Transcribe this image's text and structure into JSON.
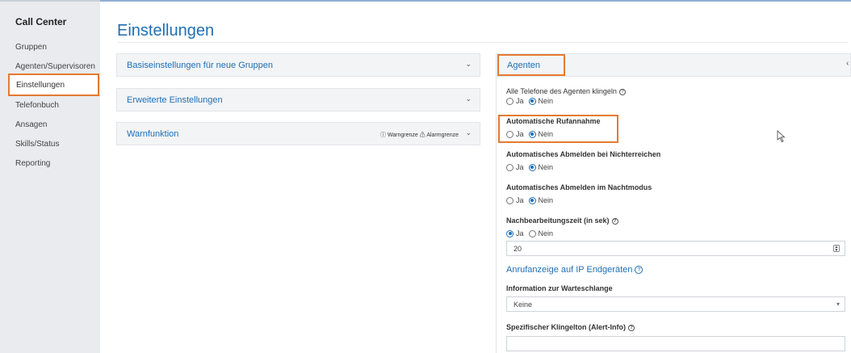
{
  "sidebar": {
    "title": "Call Center",
    "items": [
      {
        "label": "Gruppen"
      },
      {
        "label": "Agenten/Supervisoren"
      },
      {
        "label": "Einstellungen",
        "active": true
      },
      {
        "label": "Telefonbuch"
      },
      {
        "label": "Ansagen"
      },
      {
        "label": "Skills/Status"
      },
      {
        "label": "Reporting"
      }
    ]
  },
  "main": {
    "title": "Einstellungen",
    "accordions": [
      {
        "label": "Basiseinstellungen für neue Gruppen"
      },
      {
        "label": "Erweiterte Einstellungen"
      },
      {
        "label": "Warnfunktion",
        "legend": {
          "warn": "Warngrenze",
          "alarm": "Alarmgrenze"
        }
      }
    ]
  },
  "agents": {
    "header": "Agenten",
    "yes": "Ja",
    "no": "Nein",
    "ring_all": {
      "label": "Alle Telefone des Agenten klingeln"
    },
    "auto_answer": {
      "label": "Automatische Rufannahme"
    },
    "auto_logout_unreach": {
      "label": "Automatisches Abmelden bei Nichterreichen"
    },
    "auto_logout_night": {
      "label": "Automatisches Abmelden im Nachtmodus"
    },
    "wrapup": {
      "label": "Nachbearbeitungszeit (in sek)",
      "value": "20"
    },
    "call_display_link": "Anrufanzeige auf IP Endgeräten",
    "queue_info": {
      "label": "Information zur Warteschlange",
      "value": "Keine"
    },
    "ringtone": {
      "label": "Spezifischer Klingelton (Alert-Info)",
      "value": ""
    }
  },
  "colors": {
    "accent": "#1f6fb5",
    "highlight": "#e57a32",
    "sidebar_bg": "#e9ebee"
  }
}
